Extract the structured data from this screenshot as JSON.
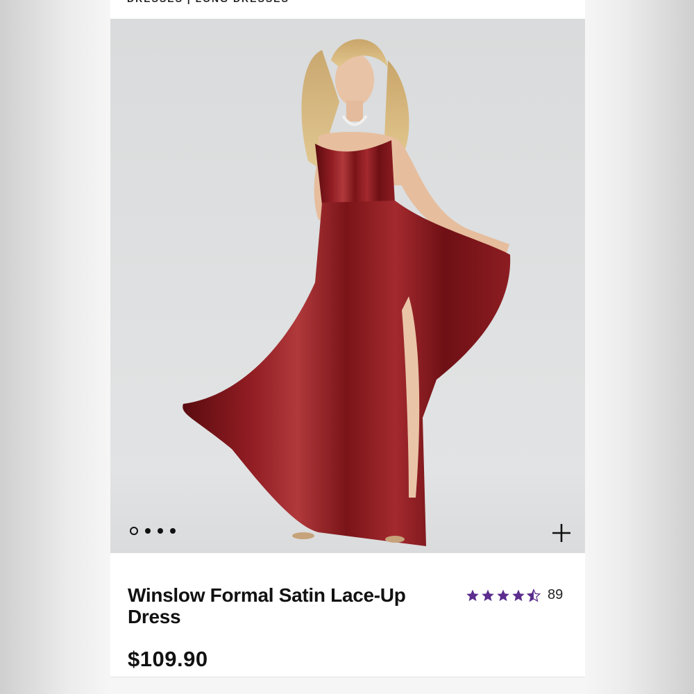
{
  "breadcrumb": "DRESSES | LONG DRESSES",
  "gallery": {
    "image_alt": "Red satin formal gown",
    "slide_count": 4,
    "active_slide": 1,
    "dress_color": "#7a1418"
  },
  "product": {
    "title": "Winslow Formal Satin Lace-Up Dress",
    "price": "$109.90",
    "rating_value": 4.5,
    "rating_count": "89",
    "star_color": "#5b2d8e"
  },
  "icons": {
    "zoom": "plus-icon",
    "star": "star-icon"
  }
}
